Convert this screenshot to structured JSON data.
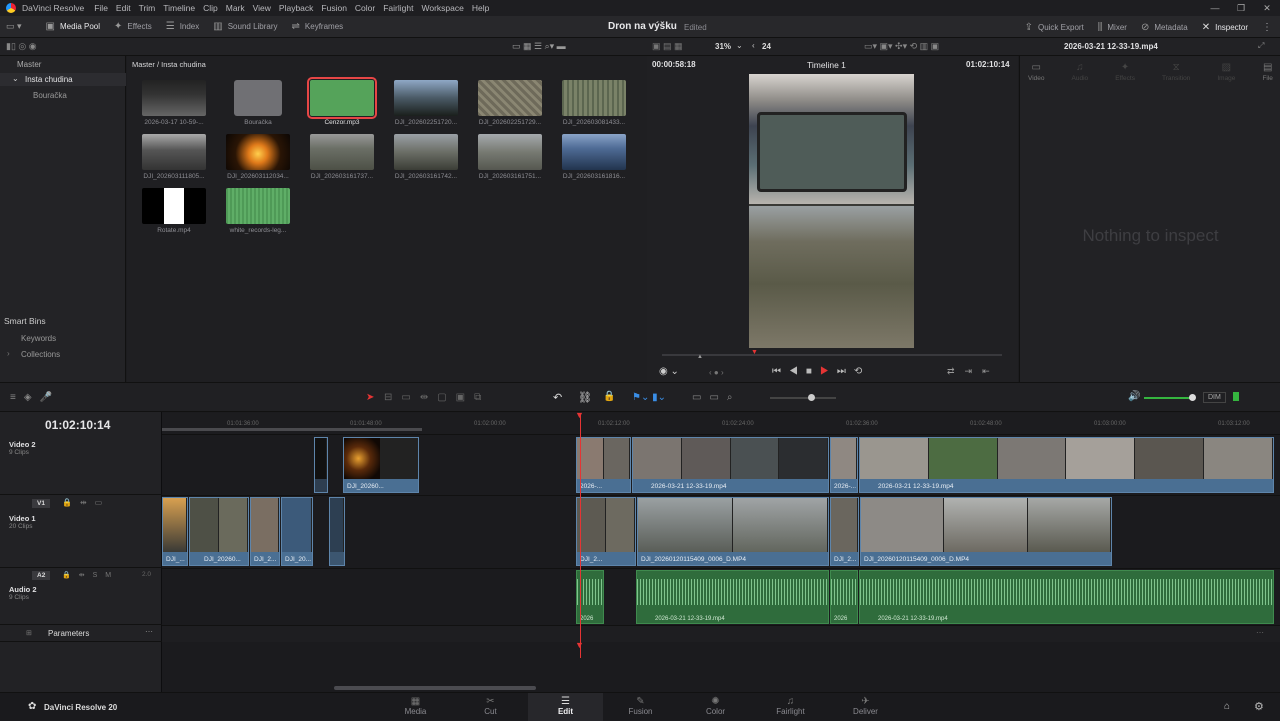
{
  "app": {
    "name": "DaVinci Resolve",
    "version_label": "DaVinci Resolve 20"
  },
  "menu": [
    "File",
    "Edit",
    "Trim",
    "Timeline",
    "Clip",
    "Mark",
    "View",
    "Playback",
    "Fusion",
    "Color",
    "Fairlight",
    "Workspace",
    "Help"
  ],
  "toolbar_left": [
    {
      "label": "Media Pool",
      "icon": "media-pool-icon"
    },
    {
      "label": "Effects",
      "icon": "effects-icon"
    },
    {
      "label": "Index",
      "icon": "index-icon"
    },
    {
      "label": "Sound Library",
      "icon": "sound-library-icon"
    },
    {
      "label": "Keyframes",
      "icon": "keyframes-icon"
    }
  ],
  "project": {
    "title": "Dron na výšku",
    "status": "Edited"
  },
  "toolbar_right": [
    {
      "label": "Quick Export"
    },
    {
      "label": "Mixer"
    },
    {
      "label": "Metadata"
    },
    {
      "label": "Inspector"
    }
  ],
  "subbar": {
    "zoom": "31%",
    "fps": "24",
    "viewer_tc": "00:00:58:18",
    "timeline_name": "Timeline 1",
    "record_tc": "01:02:10:14",
    "clip_name": "2026-03-21 12-33-19.mp4"
  },
  "bins": {
    "master": "Master",
    "items": [
      "Insta chudina",
      "Bouračka"
    ],
    "smart_title": "Smart Bins",
    "smart_items": [
      "Keywords",
      "Collections"
    ]
  },
  "pool": {
    "breadcrumb": "Master / Insta chudina",
    "clips": [
      "2026-03-17 10-59-...",
      "Bouračka",
      "Cenzor.mp3",
      "DJI_202602251720...",
      "DJI_202602251729...",
      "DJI_202603081433...",
      "DJI_202603111805...",
      "DJI_202603112034...",
      "DJI_202603161737...",
      "DJI_202603161742...",
      "DJI_202603161751...",
      "DJI_202603161816...",
      "Rotate.mp4",
      "white_records-leg..."
    ]
  },
  "inspector": {
    "tabs": [
      "Video",
      "Audio",
      "Effects",
      "Transition",
      "Image",
      "File"
    ],
    "empty": "Nothing to inspect"
  },
  "timeline": {
    "timecode": "01:02:10:14",
    "ruler": [
      "01:01:36:00",
      "01:01:48:00",
      "01:02:00:00",
      "01:02:12:00",
      "01:02:24:00",
      "01:02:36:00",
      "01:02:48:00",
      "01:03:00:00",
      "01:03:12:00"
    ],
    "tracks": [
      {
        "name": "Video 2",
        "clips": "9 Clips"
      },
      {
        "name": "Video 1",
        "clips": "20 Clips",
        "tag": "V1"
      },
      {
        "name": "Audio 2",
        "clips": "9 Clips",
        "tag": "A2",
        "level": "2.0"
      }
    ],
    "clip_labels": {
      "v2a": "DJI_20260...",
      "v2b": "2026-...",
      "v2c": "2026-03-21 12-33-19.mp4",
      "v2d": "2026-...",
      "v2e": "2026-03-21 12-33-19.mp4",
      "v1a": "DJI_...",
      "v1b": "DJI_20260...",
      "v1c": "DJI_2...",
      "v1d": "DJI_20...",
      "v1e": "DJI_2...",
      "v1f": "DJI_20260120115409_0006_D.MP4",
      "v1g": "DJI_2...",
      "v1h": "DJI_20260120115409_0006_D.MP4",
      "a1": "2026",
      "a2": "2026-03-21 12-33-19.mp4",
      "a3": "2026",
      "a4": "2026-03-21 12-33-19.mp4"
    },
    "parameters": "Parameters",
    "dim": "DIM"
  },
  "pages": [
    "Media",
    "Cut",
    "Edit",
    "Fusion",
    "Color",
    "Fairlight",
    "Deliver"
  ],
  "active_page": "Edit",
  "colors": {
    "accent": "#e53434",
    "video_clip": "#4a6f93",
    "audio_clip": "#2f6c3c"
  }
}
